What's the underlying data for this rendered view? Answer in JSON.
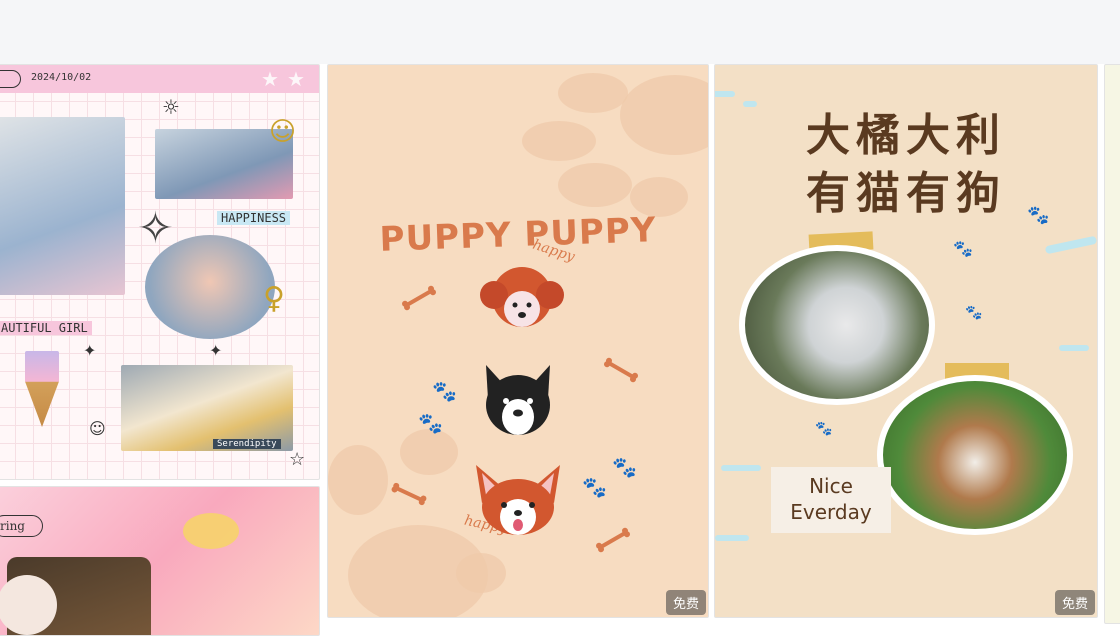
{
  "cards": [
    {
      "id": "scrapbook",
      "date": "2024/10/02",
      "tags": {
        "happiness": "HAPPINESS",
        "girl": "AUTIFUL GIRL",
        "serendipity": "Serendipity"
      }
    },
    {
      "id": "puppy",
      "title": "PUPPY PUPPY",
      "scribble_top": "happy",
      "scribble_bottom": "happy",
      "badge": "免费"
    },
    {
      "id": "catdog",
      "title_line1": "大橘大利",
      "title_line2": "有猫有狗",
      "nice_line1": "Nice",
      "nice_line2": "Everday",
      "badge": "免费"
    },
    {
      "id": "pink",
      "pill": "ring"
    }
  ],
  "colors": {
    "topbar": "#f5f6f8",
    "puppy_bg": "#f7dcc1",
    "puppy_accent": "#d97a4c",
    "catdog_bg": "#f3e0c6",
    "catdog_text": "#5a3a20"
  }
}
